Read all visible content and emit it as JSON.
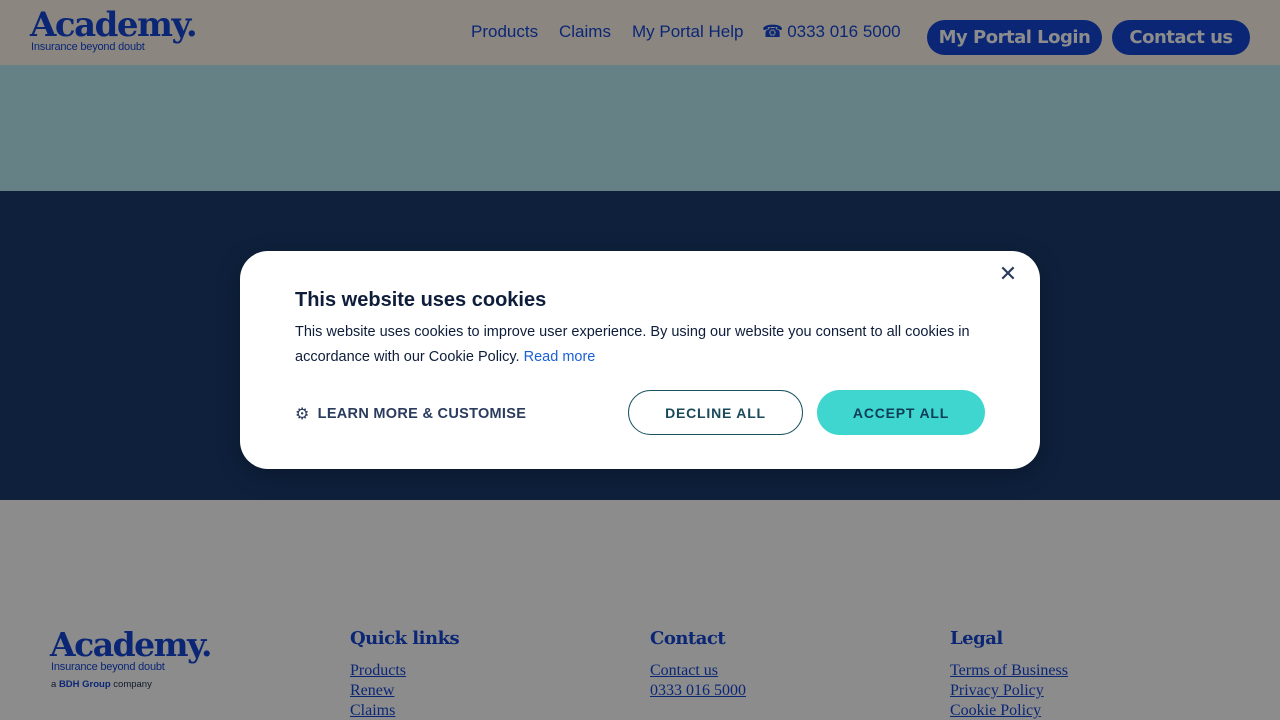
{
  "header": {
    "logo": {
      "word": "Academy.",
      "tagline": "Insurance beyond doubt"
    },
    "nav": [
      {
        "label": "Products"
      },
      {
        "label": "Claims"
      },
      {
        "label": "My Portal Help"
      }
    ],
    "phone": {
      "icon": "phone-icon",
      "glyph": "☎",
      "label": "0333 016 5000"
    },
    "login_label": "My Portal Login",
    "contact_label": "Contact us"
  },
  "footer": {
    "logo": {
      "word": "Academy.",
      "tagline": "Insurance beyond doubt",
      "group_prefix": "a",
      "group_name": "BDH Group",
      "group_suffix": "company"
    },
    "quick_links": {
      "title": "Quick links",
      "items": [
        "Products",
        "Renew",
        "Claims"
      ]
    },
    "contact": {
      "title": "Contact",
      "items": [
        "Contact us",
        "0333 016 5000"
      ]
    },
    "legal": {
      "title": "Legal",
      "items": [
        "Terms of Business",
        "Privacy Policy",
        "Cookie Policy"
      ]
    }
  },
  "cookie_modal": {
    "title": "This website uses cookies",
    "text": "This website uses cookies to improve user experience. By using our website you consent to all cookies in accordance with our Cookie Policy.",
    "read_more": "Read more",
    "learn_more": "LEARN MORE & CUSTOMISE",
    "gear_glyph": "⚙",
    "decline": "DECLINE ALL",
    "accept": "ACCEPT ALL",
    "close_glyph": "✕"
  },
  "colors": {
    "brand_blue": "#1546d6",
    "hero_light": "#b8ecf2",
    "hero_dark": "#1a3b6e",
    "accept_teal": "#3fd6d0"
  }
}
